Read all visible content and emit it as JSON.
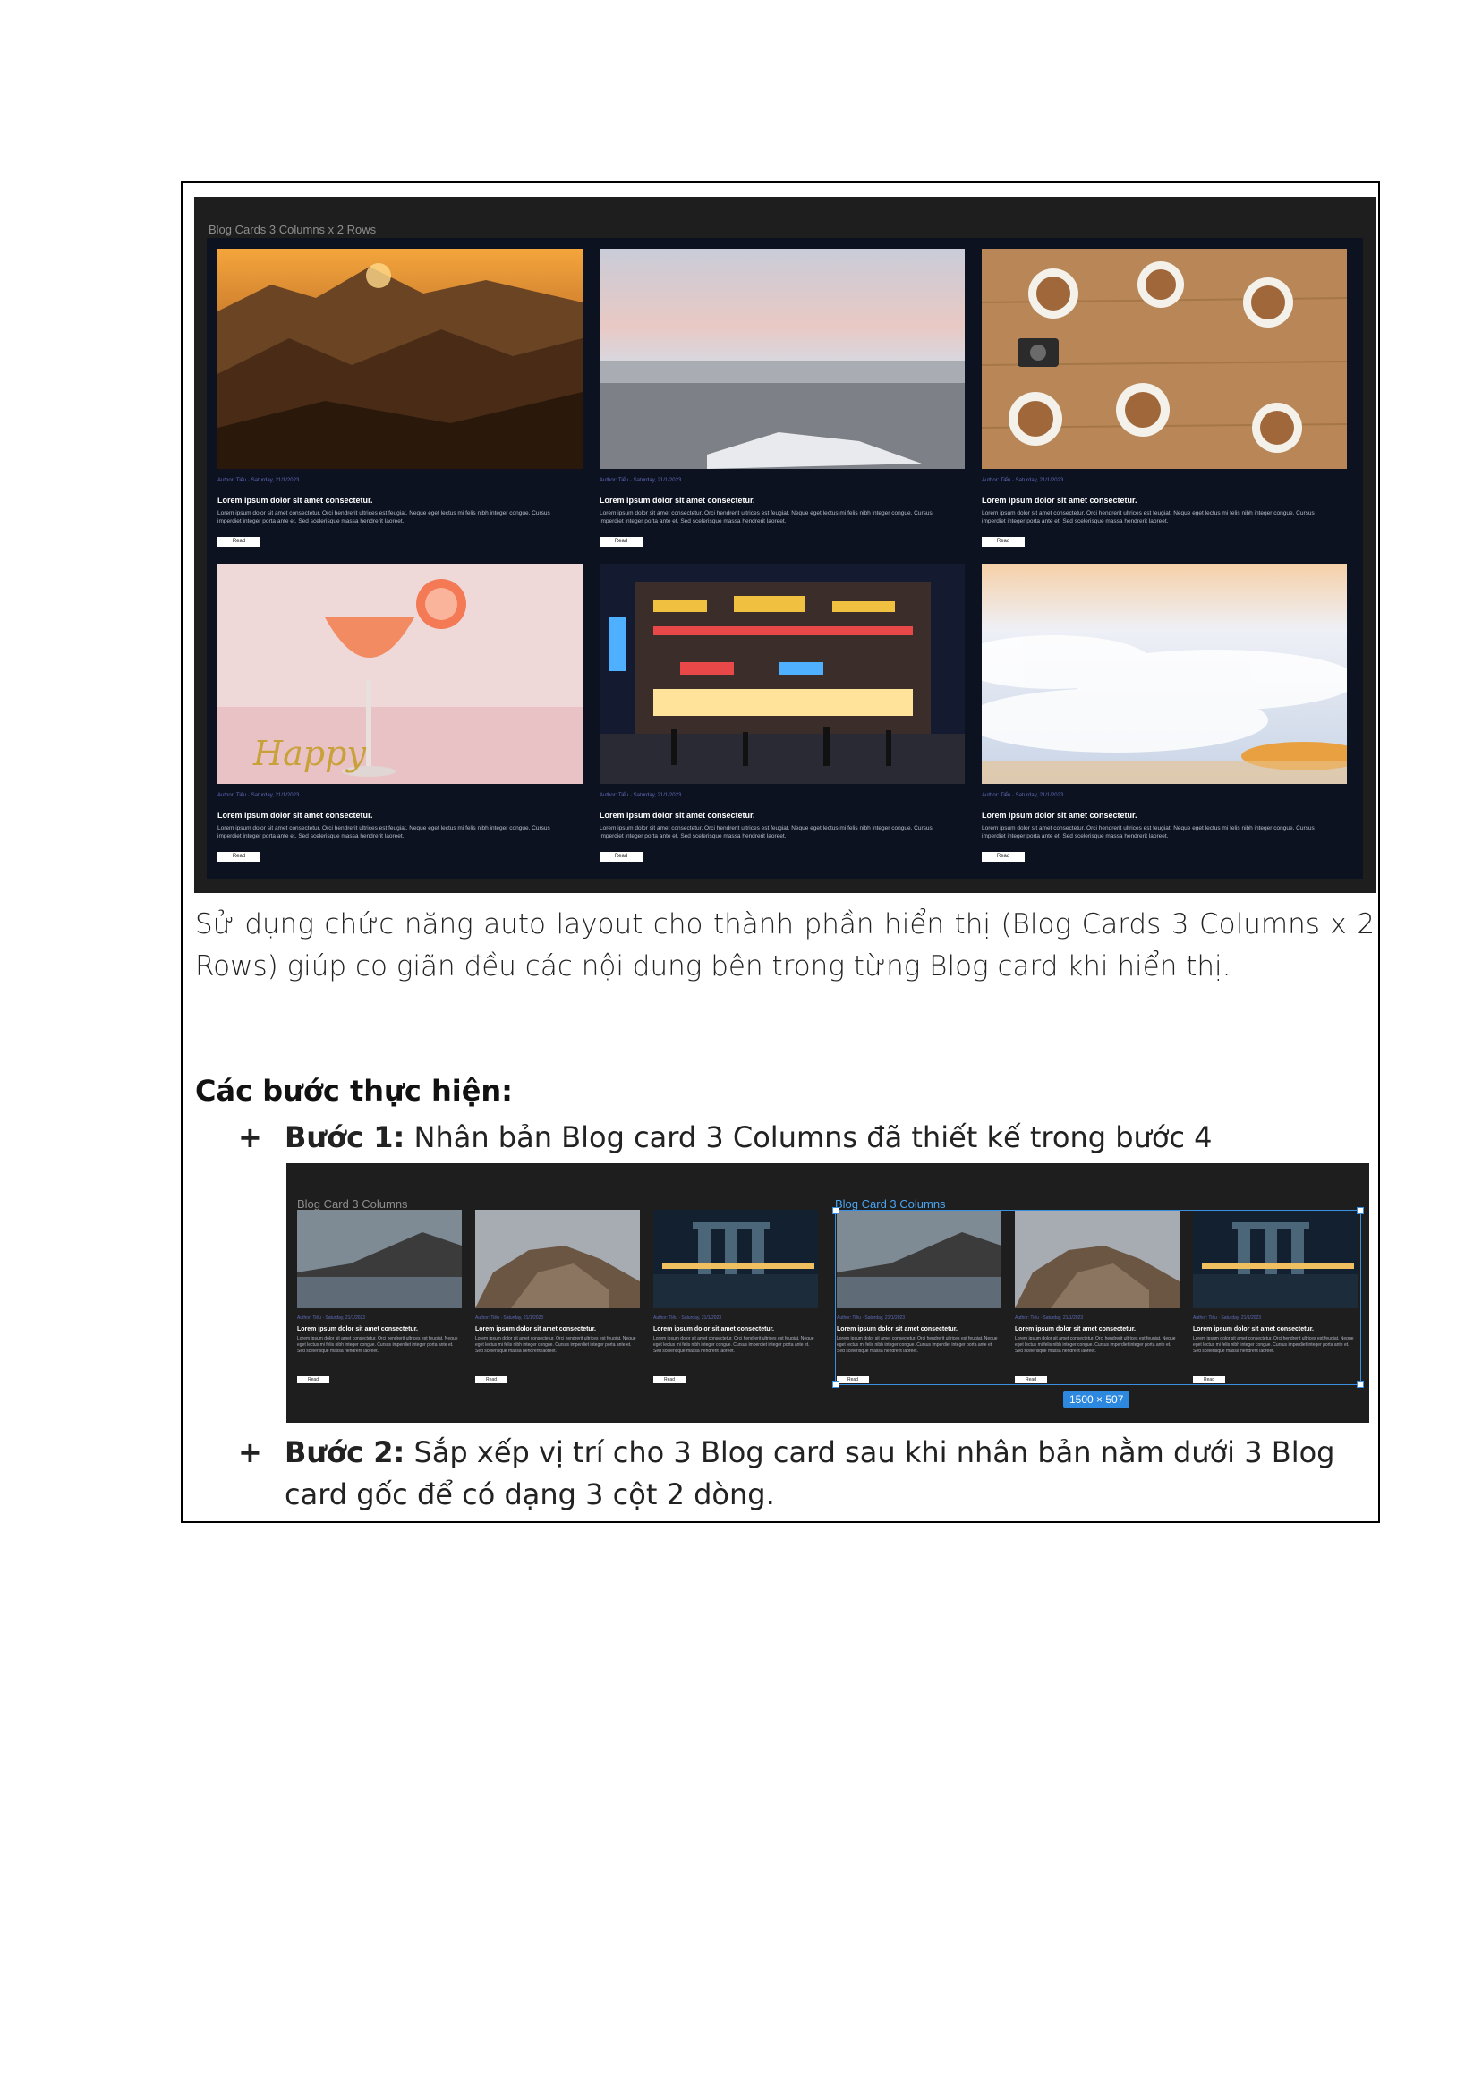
{
  "figure1": {
    "title": "Blog Cards 3 Columns x 2 Rows",
    "cards": [
      {
        "meta": "Author: Tiểu · Saturday, 21/1/2023",
        "title": "Lorem ipsum dolor sit amet consectetur.",
        "body": "Lorem ipsum dolor sit amet consectetur. Orci hendrerit ultrices est feugiat. Neque eget lectus mi felis nibh integer congue. Cursus imperdiet integer porta ante et. Sed scelerisque massa hendrerit laoreet.",
        "button": "Read",
        "image": "desert-sunset-photo"
      },
      {
        "meta": "Author: Tiểu · Saturday, 21/1/2023",
        "title": "Lorem ipsum dolor sit amet consectetur.",
        "body": "Lorem ipsum dolor sit amet consectetur. Orci hendrerit ultrices est feugiat. Neque eget lectus mi felis nibh integer congue. Cursus imperdiet integer porta ante et. Sed scelerisque massa hendrerit laoreet.",
        "button": "Read",
        "image": "snowy-forest-photo"
      },
      {
        "meta": "Author: Tiểu · Saturday, 21/1/2023",
        "title": "Lorem ipsum dolor sit amet consectetur.",
        "body": "Lorem ipsum dolor sit amet consectetur. Orci hendrerit ultrices est feugiat. Neque eget lectus mi felis nibh integer congue. Cursus imperdiet integer porta ante et. Sed scelerisque massa hendrerit laoreet.",
        "button": "Read",
        "image": "coffee-table-photo"
      },
      {
        "meta": "Author: Tiểu · Saturday, 21/1/2023",
        "title": "Lorem ipsum dolor sit amet consectetur.",
        "body": "Lorem ipsum dolor sit amet consectetur. Orci hendrerit ultrices est feugiat. Neque eget lectus mi felis nibh integer congue. Cursus imperdiet integer porta ante et. Sed scelerisque massa hendrerit laoreet.",
        "button": "Read",
        "image": "cocktail-photo"
      },
      {
        "meta": "Author: Tiểu · Saturday, 21/1/2023",
        "title": "Lorem ipsum dolor sit amet consectetur.",
        "body": "Lorem ipsum dolor sit amet consectetur. Orci hendrerit ultrices est feugiat. Neque eget lectus mi felis nibh integer congue. Cursus imperdiet integer porta ante et. Sed scelerisque massa hendrerit laoreet.",
        "button": "Read",
        "image": "city-night-photo"
      },
      {
        "meta": "Author: Tiểu · Saturday, 21/1/2023",
        "title": "Lorem ipsum dolor sit amet consectetur.",
        "body": "Lorem ipsum dolor sit amet consectetur. Orci hendrerit ultrices est feugiat. Neque eget lectus mi felis nibh integer congue. Cursus imperdiet integer porta ante et. Sed scelerisque massa hendrerit laoreet.",
        "button": "Read",
        "image": "sea-of-clouds-photo"
      }
    ]
  },
  "paragraph": "Sử dụng chức năng auto layout cho thành phần hiển thị (Blog Cards 3 Columns x 2 Rows) giúp co giãn đều các nội dung bên trong từng Blog card khi hiển thị.",
  "steps_heading": "Các bước thực hiện:",
  "steps": [
    {
      "marker": "+",
      "label": "Bước 1:",
      "text": " Nhân bản Blog card 3 Columns đã thiết kế trong bước 4"
    },
    {
      "marker": "+",
      "label": "Bước 2:",
      "text": " Sắp xếp vị trí cho 3 Blog card sau khi nhân bản nằm dưới 3 Blog card gốc để có dạng 3 cột 2 dòng."
    }
  ],
  "figure2": {
    "title_left": "Blog Card 3 Columns",
    "title_right": "Blog Card 3 Columns",
    "dimension_badge": "1500 × 507",
    "cards": [
      {
        "meta": "Author: Tiểu · Saturday, 21/1/2023",
        "title": "Lorem ipsum dolor sit amet consectetur.",
        "body": "Lorem ipsum dolor sit amet consectetur. Orci hendrerit ultrices est feugiat. Neque eget lectus mi felis nibh integer congue. Cursus imperdiet integer porta ante et. Sed scelerisque massa hendrerit laoreet.",
        "button": "Read",
        "image": "lake-mountain-photo"
      },
      {
        "meta": "Author: Tiểu · Saturday, 21/1/2023",
        "title": "Lorem ipsum dolor sit amet consectetur.",
        "body": "Lorem ipsum dolor sit amet consectetur. Orci hendrerit ultrices est feugiat. Neque eget lectus mi felis nibh integer congue. Cursus imperdiet integer porta ante et. Sed scelerisque massa hendrerit laoreet.",
        "button": "Read",
        "image": "rock-peak-photo"
      },
      {
        "meta": "Author: Tiểu · Saturday, 21/1/2023",
        "title": "Lorem ipsum dolor sit amet consectetur.",
        "body": "Lorem ipsum dolor sit amet consectetur. Orci hendrerit ultrices est feugiat. Neque eget lectus mi felis nibh integer congue. Cursus imperdiet integer porta ante et. Sed scelerisque massa hendrerit laoreet.",
        "button": "Read",
        "image": "marina-bay-photo"
      },
      {
        "meta": "Author: Tiểu · Saturday, 21/1/2023",
        "title": "Lorem ipsum dolor sit amet consectetur.",
        "body": "Lorem ipsum dolor sit amet consectetur. Orci hendrerit ultrices est feugiat. Neque eget lectus mi felis nibh integer congue. Cursus imperdiet integer porta ante et. Sed scelerisque massa hendrerit laoreet.",
        "button": "Read",
        "image": "lake-mountain-photo"
      },
      {
        "meta": "Author: Tiểu · Saturday, 21/1/2023",
        "title": "Lorem ipsum dolor sit amet consectetur.",
        "body": "Lorem ipsum dolor sit amet consectetur. Orci hendrerit ultrices est feugiat. Neque eget lectus mi felis nibh integer congue. Cursus imperdiet integer porta ante et. Sed scelerisque massa hendrerit laoreet.",
        "button": "Read",
        "image": "rock-peak-photo"
      },
      {
        "meta": "Author: Tiểu · Saturday, 21/1/2023",
        "title": "Lorem ipsum dolor sit amet consectetur.",
        "body": "Lorem ipsum dolor sit amet consectetur. Orci hendrerit ultrices est feugiat. Neque eget lectus mi felis nibh integer congue. Cursus imperdiet integer porta ante et. Sed scelerisque massa hendrerit laoreet.",
        "button": "Read",
        "image": "marina-bay-photo"
      }
    ]
  },
  "colors": {
    "canvas": "#1e1e1e",
    "card_bg": "#0d1220",
    "meta": "#5e6bb8",
    "selection": "#3b8fe0"
  }
}
